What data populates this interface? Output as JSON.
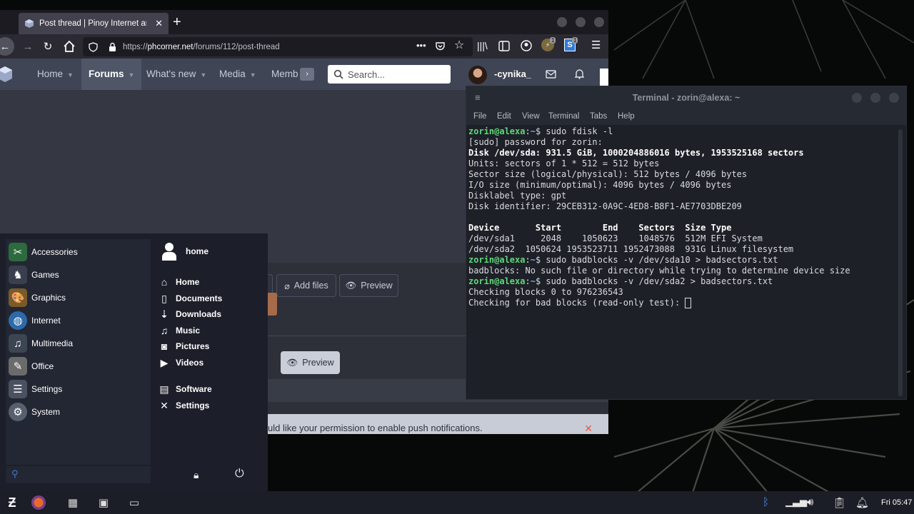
{
  "browser": {
    "tab_title": "Post thread | Pinoy Internet and",
    "url_prefix": "https://",
    "url_domain": "phcorner.net",
    "url_path": "/forums/112/post-thread",
    "badge_count_1": "1",
    "badge_count_2": "1"
  },
  "site": {
    "nav": [
      "Home",
      "Forums",
      "What's new",
      "Media",
      "Memb"
    ],
    "search_placeholder": "Search...",
    "username": "-cynika_",
    "add_files_label": "Add files",
    "preview_label": "Preview",
    "preview2_label": "Preview",
    "push_notice": "uld like your permission to enable push notifications."
  },
  "terminal": {
    "title": "Terminal - zorin@alexa: ~",
    "menu": [
      "File",
      "Edit",
      "View",
      "Terminal",
      "Tabs",
      "Help"
    ],
    "prompt_user": "zorin@alexa",
    "prompt_path": "~",
    "lines": {
      "cmd1": "$ sudo fdisk -l",
      "l2": "[sudo] password for zorin:",
      "l3": "Disk /dev/sda: 931.5 GiB, 1000204886016 bytes, 1953525168 sectors",
      "l4": "Units: sectors of 1 * 512 = 512 bytes",
      "l5": "Sector size (logical/physical): 512 bytes / 4096 bytes",
      "l6": "I/O size (minimum/optimal): 4096 bytes / 4096 bytes",
      "l7": "Disklabel type: gpt",
      "l8": "Disk identifier: 29CEB312-0A9C-4ED8-B8F1-AE7703DBE209",
      "hdr": "Device       Start        End    Sectors  Size Type",
      "p1": "/dev/sda1     2048    1050623    1048576  512M EFI System",
      "p2": "/dev/sda2  1050624 1953523711 1952473088  931G Linux filesystem",
      "cmd2": "$ sudo badblocks -v /dev/sda10 > badsectors.txt",
      "err": "badblocks: No such file or directory while trying to determine device size",
      "cmd3": "$ sudo badblocks -v /dev/sda2 > badsectors.txt",
      "c1": "Checking blocks 0 to 976236543",
      "c2": "Checking for bad blocks (read-only test): "
    }
  },
  "startmenu": {
    "user": "home",
    "categories": [
      "Accessories",
      "Games",
      "Graphics",
      "Internet",
      "Multimedia",
      "Office",
      "Settings",
      "System"
    ],
    "places": [
      "Home",
      "Documents",
      "Downloads",
      "Music",
      "Pictures",
      "Videos"
    ],
    "apps": [
      "Software",
      "Settings"
    ]
  },
  "taskbar": {
    "clock": "Fri 05:47"
  },
  "colors": {
    "terminal_prompt": "#5fd87a",
    "terminal_path": "#6aa9ff",
    "site_nav_bg": "#3f4554"
  }
}
